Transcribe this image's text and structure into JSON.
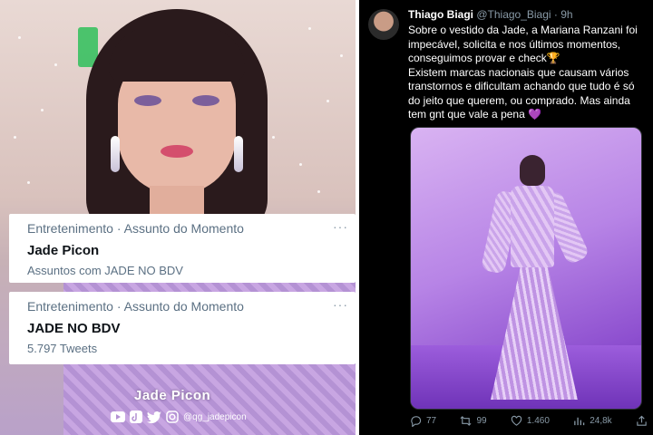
{
  "left_panel": {
    "watermark_name": "Jade Picon",
    "watermark_handle": "@qg_jadepicon",
    "trends": [
      {
        "meta": "Entretenimento · Assunto do Momento",
        "title": "Jade Picon",
        "subtitle": "Assuntos com JADE NO BDV",
        "more": "···"
      },
      {
        "meta": "Entretenimento · Assunto do Momento",
        "title": "JADE NO BDV",
        "subtitle": "5.797 Tweets",
        "more": "···"
      }
    ]
  },
  "tweet": {
    "author_name": "Thiago Biagi",
    "author_handle": "@Thiago_Biagi",
    "time": "· 9h",
    "paragraph1": "Sobre o vestido da Jade, a Mariana Ranzani foi impecável, solicita e nos últimos momentos, conseguimos provar e check🏆",
    "paragraph2": "Existem marcas nacionais que causam vários transtornos e dificultam achando que tudo é só do jeito que querem, ou comprado. Mas ainda tem gnt que vale a pena 💜",
    "replies": "77",
    "retweets": "99",
    "likes": "1.460",
    "views": "24,8k"
  },
  "colors": {
    "twitter_bg": "#000000",
    "muted": "#8899a6",
    "trend_text": "#0f1419",
    "trend_meta": "#5b7083"
  }
}
